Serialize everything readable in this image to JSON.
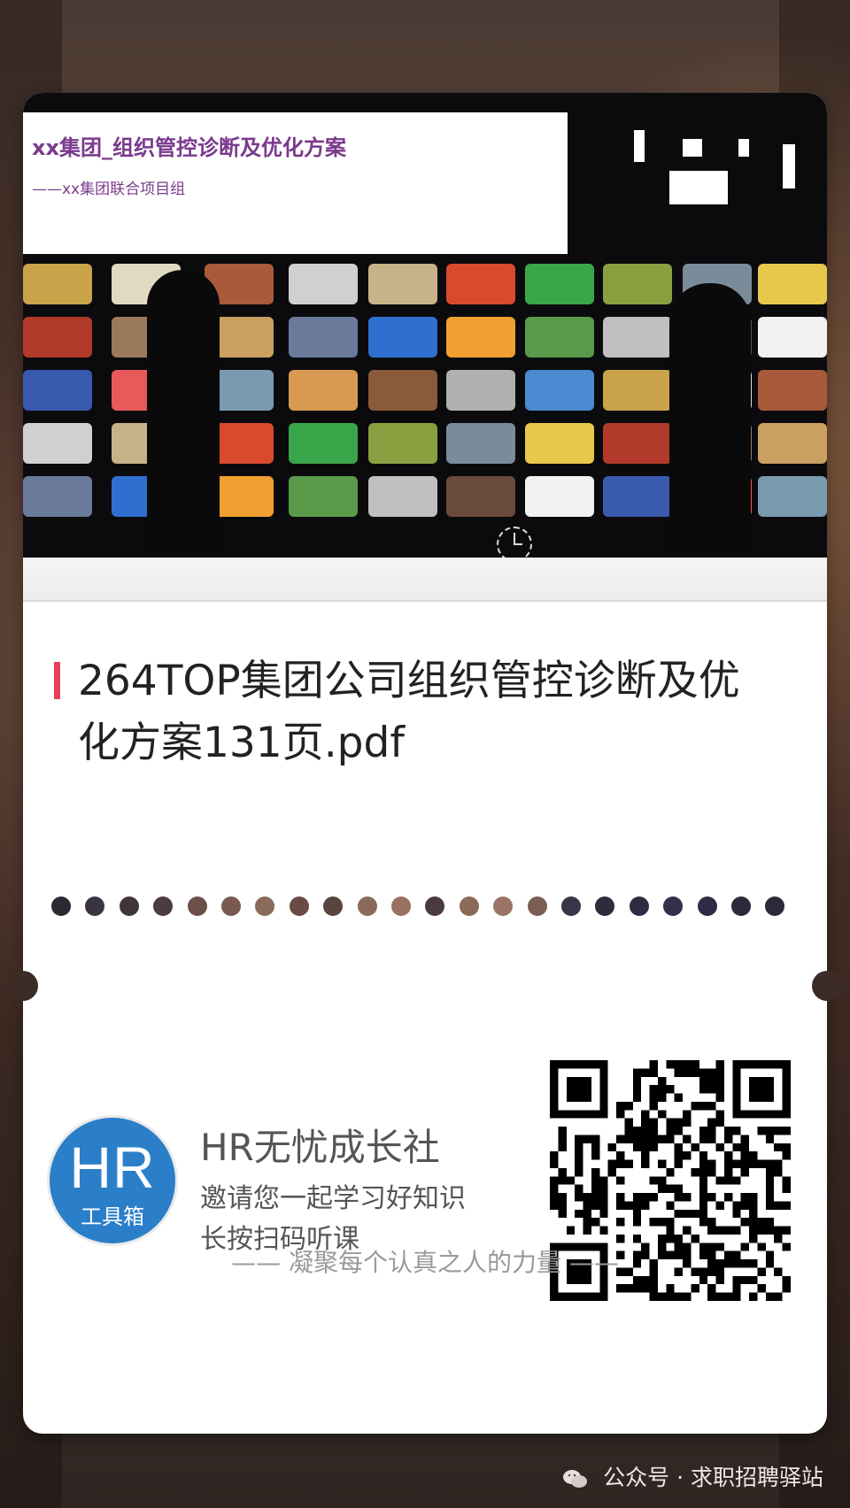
{
  "cover": {
    "title": "xx集团_组织管控诊断及优化方案",
    "subtitle": "——xx集团联合项目组"
  },
  "document": {
    "title": "264TOP集团公司组织管控诊断及优化方案131页.pdf"
  },
  "brand": {
    "logo_text": "HR",
    "logo_sub": "工具箱",
    "name": "HR无忧成长社",
    "line1": "邀请您一起学习好知识",
    "line2": "长按扫码听课"
  },
  "motto": "—— 凝聚每个认真之人的力量 ——",
  "footer": {
    "icon": "wechat-icon",
    "text": "公众号 · 求职招聘驿站"
  },
  "colors": {
    "accent": "#e83e5a",
    "logo_blue": "#2b7fc9",
    "cover_title": "#7a3a8c"
  }
}
